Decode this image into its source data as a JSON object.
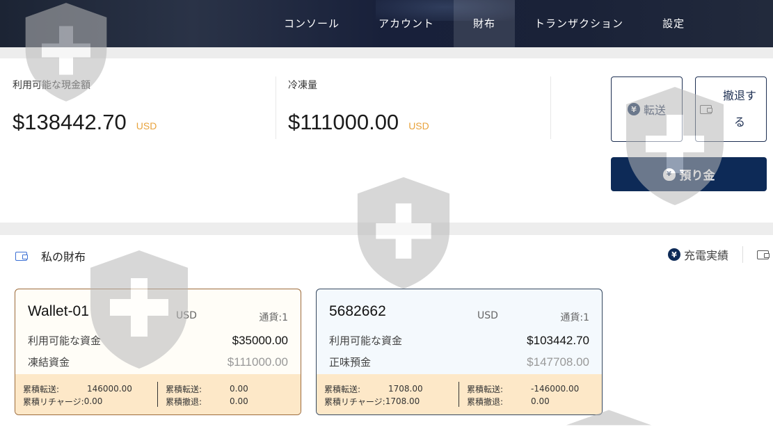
{
  "nav": {
    "items": [
      "コンソール",
      "アカウント",
      "財布",
      "トランザクション",
      "設定"
    ],
    "active_index": 2
  },
  "balances": {
    "available": {
      "label": "利用可能な現金額",
      "amount": "$138442.70",
      "currency": "USD"
    },
    "frozen": {
      "label": "冷凍量",
      "amount": "$111000.00",
      "currency": "USD"
    }
  },
  "actions": {
    "transfer_label": "転送",
    "transfer_icon": "¥",
    "withdraw_label_line1": "撤退す",
    "withdraw_label_line2": "る",
    "deposit_label": "預り金",
    "deposit_icon": "¥"
  },
  "wallets": {
    "title": "私の財布",
    "recharge_record_label": "充電実績",
    "recharge_icon": "¥",
    "cards": [
      {
        "name": "Wallet-01",
        "currency": "USD",
        "count_label": "通貨:1",
        "available_label": "利用可能な資金",
        "available_value": "$35000.00",
        "second_label": "凍結資金",
        "second_value": "$111000.00",
        "foot": {
          "transfer_in_label": "累積転送:",
          "transfer_in_value": "146000.00",
          "recharge_label": "累積リチャージ:",
          "recharge_value": "0.00",
          "transfer_out_label": "累積転送:",
          "transfer_out_value": "0.00",
          "withdraw_label": "累積撤退:",
          "withdraw_value": "0.00"
        }
      },
      {
        "name": "5682662",
        "currency": "USD",
        "count_label": "通貨:1",
        "available_label": "利用可能な資金",
        "available_value": "$103442.70",
        "second_label": "正味預金",
        "second_value": "$147708.00",
        "foot": {
          "transfer_in_label": "累積転送:",
          "transfer_in_value": "1708.00",
          "recharge_label": "累積リチャージ:",
          "recharge_value": "1708.00",
          "transfer_out_label": "累積転送:",
          "transfer_out_value": "-146000.00",
          "withdraw_label": "累積撤退:",
          "withdraw_value": "0.00"
        }
      }
    ]
  },
  "colors": {
    "header_bg": "#1c2434",
    "primary": "#0d2a57",
    "currency_accent": "#e8a33d",
    "card_footer": "#fde8c8"
  }
}
